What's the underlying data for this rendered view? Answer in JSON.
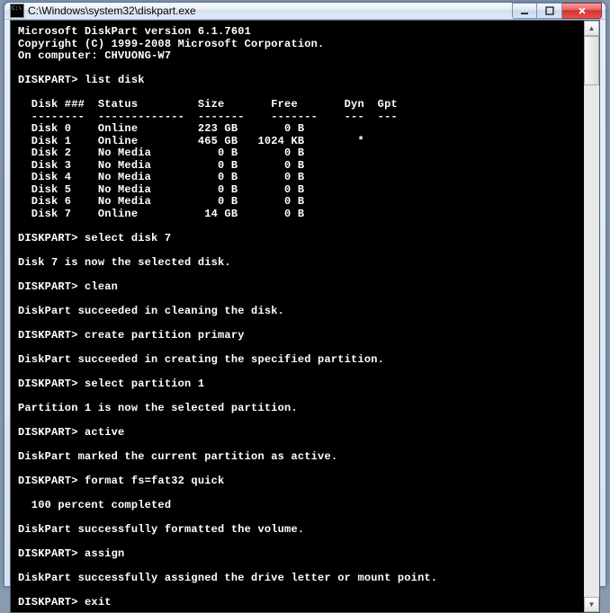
{
  "window": {
    "title": "C:\\Windows\\system32\\diskpart.exe"
  },
  "console": {
    "header": {
      "product_line": "Microsoft DiskPart version 6.1.7601",
      "copyright_line": "Copyright (C) 1999-2008 Microsoft Corporation.",
      "computer_line": "On computer: CHVUONG-W7"
    },
    "prompt": "DISKPART>",
    "commands": {
      "list_disk": "list disk",
      "select_disk": "select disk 7",
      "clean": "clean",
      "create_partition": "create partition primary",
      "select_partition": "select partition 1",
      "active": "active",
      "format": "format fs=fat32 quick",
      "assign": "assign",
      "exit": "exit"
    },
    "table": {
      "headers": {
        "disk": "Disk ###",
        "status": "Status",
        "size": "Size",
        "free": "Free",
        "dyn": "Dyn",
        "gpt": "Gpt"
      },
      "rows": [
        {
          "disk": "Disk 0",
          "status": "Online",
          "size": "223 GB",
          "free": "0 B",
          "dyn": "",
          "gpt": ""
        },
        {
          "disk": "Disk 1",
          "status": "Online",
          "size": "465 GB",
          "free": "1024 KB",
          "dyn": "",
          "gpt": "*"
        },
        {
          "disk": "Disk 2",
          "status": "No Media",
          "size": "0 B",
          "free": "0 B",
          "dyn": "",
          "gpt": ""
        },
        {
          "disk": "Disk 3",
          "status": "No Media",
          "size": "0 B",
          "free": "0 B",
          "dyn": "",
          "gpt": ""
        },
        {
          "disk": "Disk 4",
          "status": "No Media",
          "size": "0 B",
          "free": "0 B",
          "dyn": "",
          "gpt": ""
        },
        {
          "disk": "Disk 5",
          "status": "No Media",
          "size": "0 B",
          "free": "0 B",
          "dyn": "",
          "gpt": ""
        },
        {
          "disk": "Disk 6",
          "status": "No Media",
          "size": "0 B",
          "free": "0 B",
          "dyn": "",
          "gpt": ""
        },
        {
          "disk": "Disk 7",
          "status": "Online",
          "size": "14 GB",
          "free": "0 B",
          "dyn": "",
          "gpt": ""
        }
      ]
    },
    "messages": {
      "disk_selected": "Disk 7 is now the selected disk.",
      "clean_ok": "DiskPart succeeded in cleaning the disk.",
      "partition_created": "DiskPart succeeded in creating the specified partition.",
      "partition_selected": "Partition 1 is now the selected partition.",
      "active_ok": "DiskPart marked the current partition as active.",
      "format_progress": "  100 percent completed",
      "format_ok": "DiskPart successfully formatted the volume.",
      "assign_ok": "DiskPart successfully assigned the drive letter or mount point."
    }
  }
}
